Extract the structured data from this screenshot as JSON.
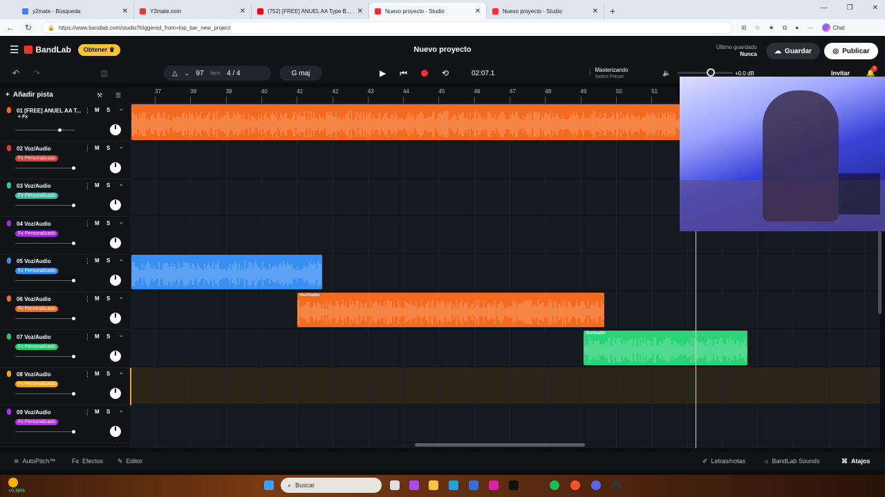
{
  "browser": {
    "tabs": [
      {
        "title": "y2mate - Búsqueda",
        "favicon_color": "#4a7cff"
      },
      {
        "title": "Y2mate.com",
        "favicon_color": "#e53935"
      },
      {
        "title": "(752) [FREE] ANUEL AA Type Beat",
        "favicon_color": "#ff0000"
      },
      {
        "title": "Nuevo proyecto - Studio",
        "favicon_color": "#f2322a"
      },
      {
        "title": "Nuevo proyecto - Studio",
        "favicon_color": "#f2322a"
      }
    ],
    "url": "https://www.bandlab.com/studio?triggered_from=top_bar_new_project",
    "chat_label": "Chat"
  },
  "app": {
    "logo_text": "BandLab",
    "obtener_label": "Obtener",
    "project_title": "Nuevo proyecto",
    "saved_label": "Último guardado",
    "saved_value": "Nunca",
    "guardar_label": "Guardar",
    "publicar_label": "Publicar"
  },
  "transport": {
    "bpm_value": "97",
    "bpm_unit": "bpm",
    "time_signature": "4 / 4",
    "key": "G maj",
    "time_display": "02:07.1",
    "mastering_label": "Masterizando",
    "mastering_preset": "Select Preset",
    "volume_db": "+0.0 dB",
    "invitar_label": "Invitar",
    "notification_count": "1"
  },
  "ruler": {
    "bars": [
      "37",
      "38",
      "39",
      "40",
      "41",
      "42",
      "43",
      "44",
      "45",
      "46",
      "47",
      "48",
      "49",
      "50",
      "51"
    ]
  },
  "tracks_panel": {
    "add_track_label": "Añadir pista",
    "mute_label": "M",
    "solo_label": "S",
    "tracks": [
      {
        "name": "01  [FREE] ANUEL AA T...",
        "fx": "+ Fx",
        "color": "#f46a1e"
      },
      {
        "name": "02  Voz/Audio",
        "fx": "Fx Personalizado",
        "color": "#e53935"
      },
      {
        "name": "03  Voz/Audio",
        "fx": "Fx Personalizado",
        "color": "#2ec4a6"
      },
      {
        "name": "04  Voz/Audio",
        "fx": "Fx Personalizado",
        "color": "#9b2fe0"
      },
      {
        "name": "05  Voz/Audio",
        "fx": "Fx Personalizado",
        "color": "#3a8ef0"
      },
      {
        "name": "06  Voz/Audio",
        "fx": "Fx Personalizado",
        "color": "#f46a1e"
      },
      {
        "name": "07  Voz/Audio",
        "fx": "Fx Personalizado",
        "color": "#29c46b"
      },
      {
        "name": "08  Voz/Audio",
        "fx": "Fx Personalizado",
        "color": "#f2a622"
      },
      {
        "name": "09  Voz/Audio",
        "fx": "Fx Personalizado",
        "color": "#b12ff0"
      }
    ]
  },
  "clips": [
    {
      "label": "",
      "color": "#f46a1e"
    },
    {
      "label": "",
      "color": "#3a8ef0"
    },
    {
      "label": "Voz/Audio",
      "color": "#f46a1e"
    },
    {
      "label": "Voz/Audio",
      "color": "#2ad378"
    }
  ],
  "bottom_bar": {
    "autopitch_label": "AutoPitch™",
    "efectos_label": "Efectos",
    "editor_label": "Editor",
    "letras_label": "Letras/notas",
    "sounds_label": "BandLab Sounds",
    "atajos_label": "Atajos"
  },
  "taskbar": {
    "weather_value": "+0,38%",
    "search_placeholder": "Buscar"
  }
}
